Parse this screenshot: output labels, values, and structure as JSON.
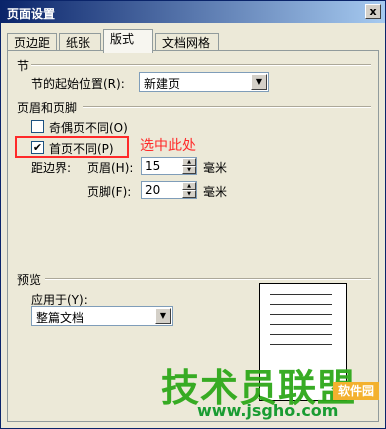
{
  "window": {
    "title": "页面设置",
    "close_glyph": "x"
  },
  "tabs": [
    {
      "label": "页边距"
    },
    {
      "label": "纸张"
    },
    {
      "label": "版式"
    },
    {
      "label": "文档网格"
    }
  ],
  "section": {
    "group_title": "节",
    "start_label": "节的起始位置(R):",
    "start_value": "新建页"
  },
  "header_footer": {
    "group_title": "页眉和页脚",
    "odd_even_label": "奇偶页不同(O)",
    "odd_even_checked": false,
    "first_page_label": "首页不同(P)",
    "first_page_checked": true,
    "distance_label": "距边界:",
    "header_label": "页眉(H):",
    "header_value": "15",
    "header_unit": "毫米",
    "footer_label": "页脚(F):",
    "footer_value": "20",
    "footer_unit": "毫米"
  },
  "annotation": {
    "text": "选中此处",
    "color": "#ff2a2a"
  },
  "preview": {
    "group_title": "预览",
    "apply_label": "应用于(Y):",
    "apply_value": "整篇文档"
  },
  "watermark": {
    "logo_text": "技术员联盟",
    "side_text": "软件园",
    "url_text": "www.jsgho.com"
  },
  "colors": {
    "accent_green": "#2ea81a",
    "window_bg": "#ece9d8",
    "title_start": "#0a246a"
  }
}
